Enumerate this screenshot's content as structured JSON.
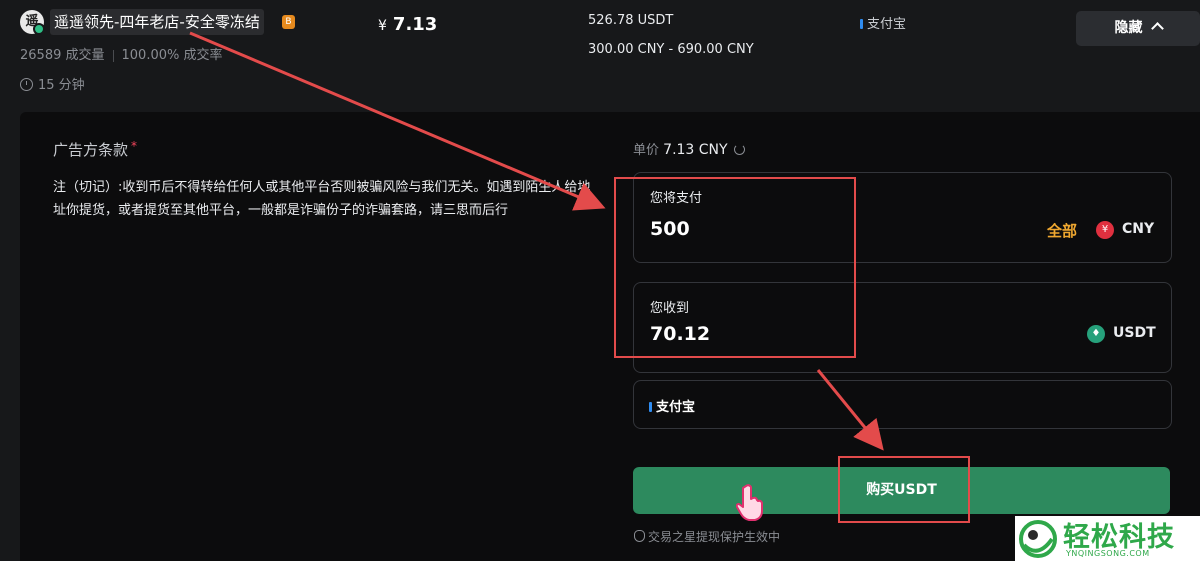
{
  "seller": {
    "avatar_char": "遥",
    "name": "遥遥领先-四年老店-安全零冻结",
    "badge": "B",
    "trades": "26589 成交量",
    "completion": "100.00% 成交率",
    "time_limit": "15 分钟"
  },
  "offer": {
    "price_symbol": "¥",
    "price": "7.13",
    "available": "526.78 USDT",
    "limit": "300.00 CNY - 690.00 CNY",
    "payment_method": "支付宝",
    "hide_label": "隐藏"
  },
  "terms": {
    "title": "广告方条款",
    "required_mark": "*",
    "text": "注（切记）:收到币后不得转给任何人或其他平台否则被骗风险与我们无关。如遇到陌生人给地址你提货，或者提货至其他平台，一般都是诈骗份子的诈骗套路，请三思而后行"
  },
  "order": {
    "unit_price_label": "单价",
    "unit_price": "7.13 CNY",
    "pay_label": "您将支付",
    "pay_value": "500",
    "all_label": "全部",
    "pay_currency": "CNY",
    "receive_label": "您收到",
    "receive_value": "70.12",
    "receive_currency": "USDT",
    "payment_method": "支付宝",
    "buy_button": "购买USDT",
    "protection_note": "交易之星提现保护生效中"
  },
  "watermark": {
    "cn": "轻松科技",
    "en": "YNQINGSONG.COM"
  },
  "colors": {
    "background": "#17181a",
    "panel": "#0c0c0d",
    "buy_green": "#2d8a5e",
    "accent_orange": "#f0a830",
    "annotation_red": "#e34b4b"
  }
}
